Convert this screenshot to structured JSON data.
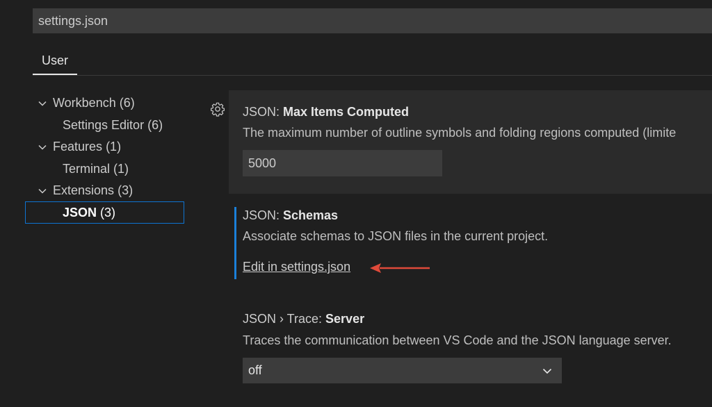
{
  "search": {
    "value": "settings.json"
  },
  "tabs": [
    {
      "label": "User"
    }
  ],
  "toc": {
    "items": [
      {
        "label": "Workbench",
        "count": "(6)",
        "expanded": true
      },
      {
        "label": "Settings Editor",
        "count": "(6)"
      },
      {
        "label": "Features",
        "count": "(1)",
        "expanded": true
      },
      {
        "label": "Terminal",
        "count": "(1)"
      },
      {
        "label": "Extensions",
        "count": "(3)",
        "expanded": true
      },
      {
        "label": "JSON",
        "count": "(3)",
        "selected": true
      }
    ]
  },
  "settings": [
    {
      "category": "JSON: ",
      "key": "Max Items Computed",
      "description": "The maximum number of outline symbols and folding regions computed (limite",
      "value": "5000"
    },
    {
      "category": "JSON: ",
      "key": "Schemas",
      "description": "Associate schemas to JSON files in the current project.",
      "link_label": "Edit in settings.json"
    },
    {
      "category": "JSON › Trace: ",
      "key": "Server",
      "description": "Traces the communication between VS Code and the JSON language server.",
      "value": "off"
    }
  ],
  "colors": {
    "accent": "#1b80d9",
    "annotation_arrow": "#e04a3a",
    "background": "#1f1f1f"
  },
  "icons": {
    "gear": "gear-icon",
    "chevron": "chevron-down-icon"
  }
}
